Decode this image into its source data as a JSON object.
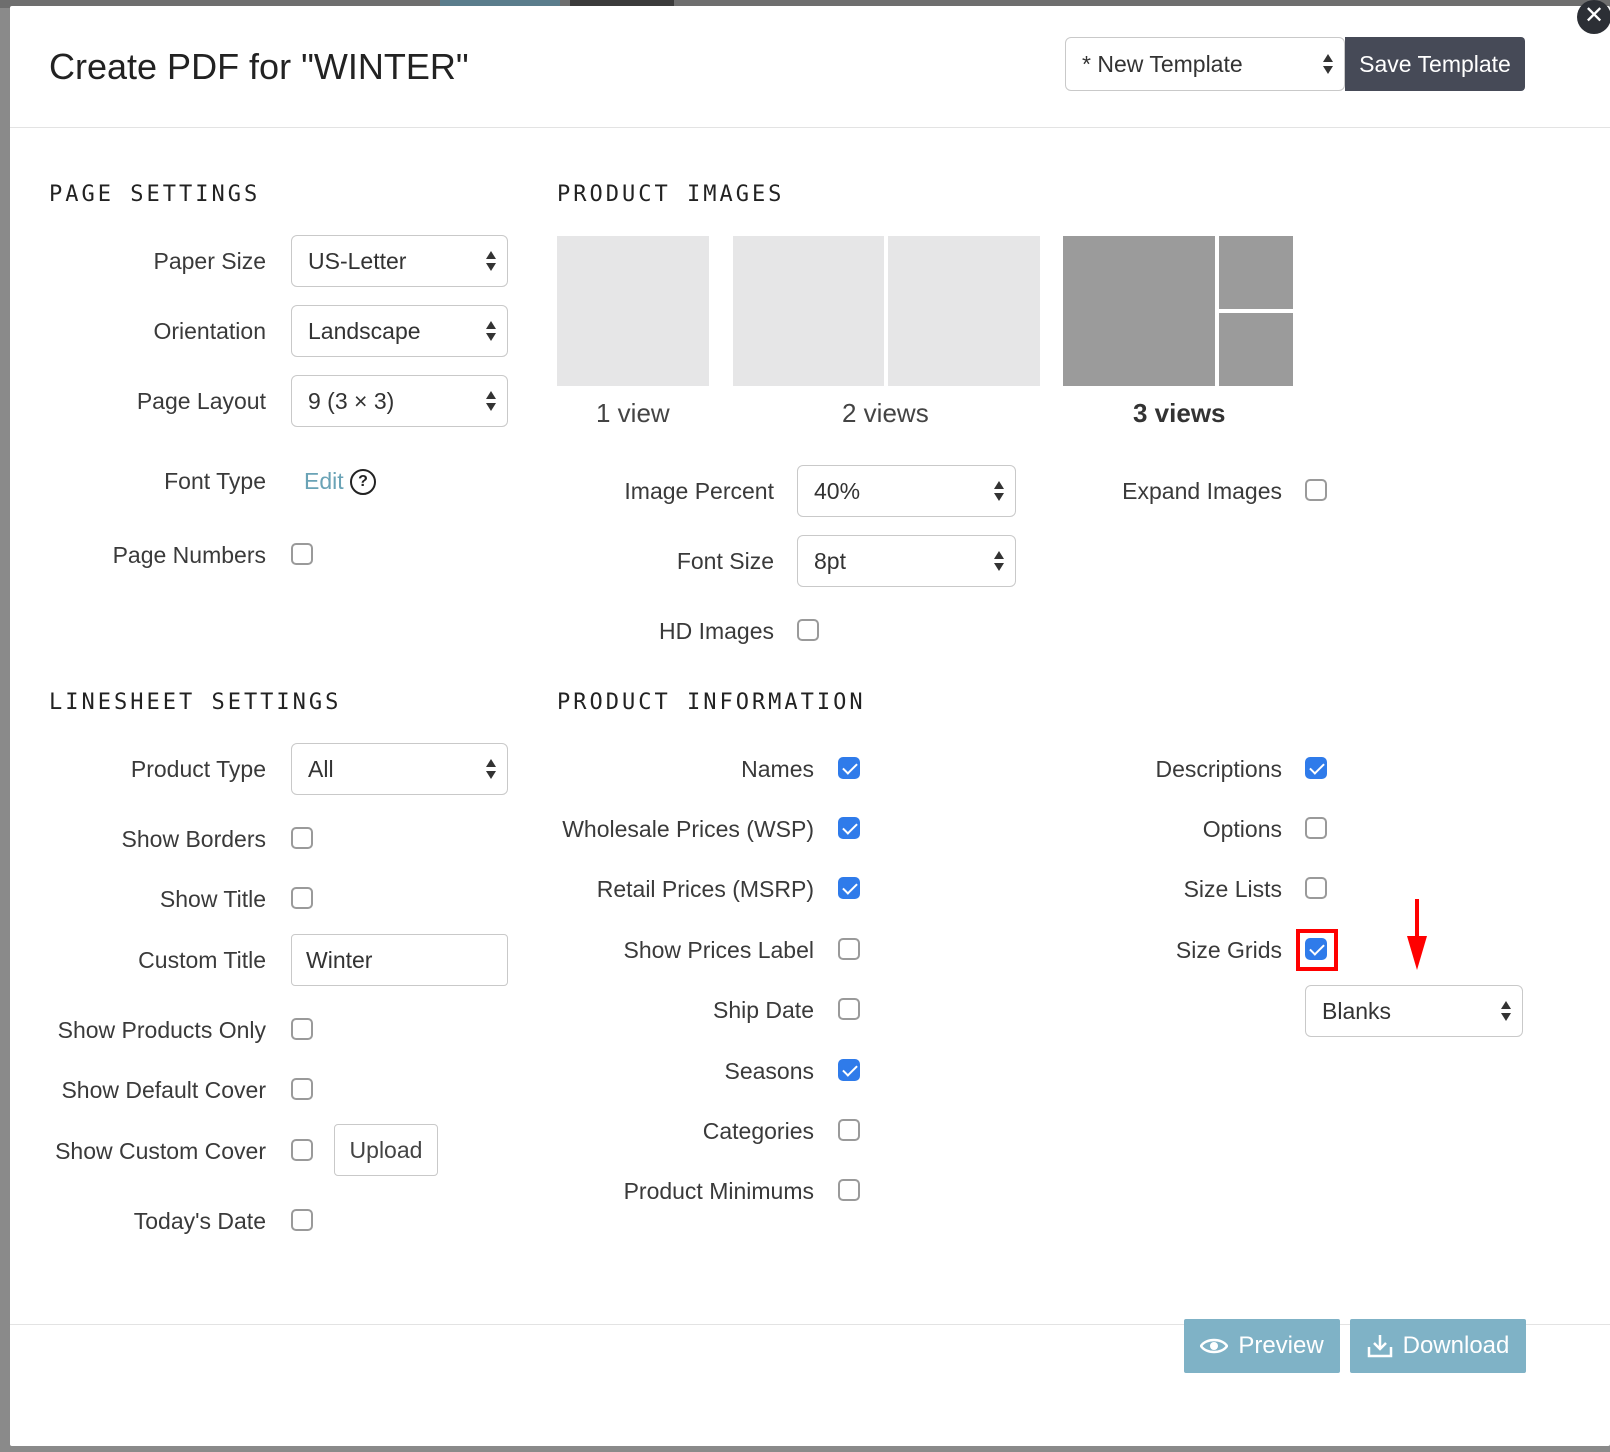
{
  "dialog": {
    "title": "Create PDF for \"WINTER\"",
    "template_select": "* New Template",
    "save_template": "Save Template",
    "close_glyph": "✕"
  },
  "page_settings": {
    "title": "PAGE SETTINGS",
    "paper_size_label": "Paper Size",
    "paper_size": "US-Letter",
    "orientation_label": "Orientation",
    "orientation": "Landscape",
    "page_layout_label": "Page Layout",
    "page_layout": "9 (3 × 3)",
    "font_type_label": "Font Type",
    "font_type_link": "Edit",
    "page_numbers_label": "Page Numbers"
  },
  "product_images": {
    "title": "PRODUCT IMAGES",
    "views": [
      "1 view",
      "2 views",
      "3 views"
    ],
    "selected": "3 views",
    "image_percent_label": "Image Percent",
    "image_percent": "40%",
    "font_size_label": "Font Size",
    "font_size": "8pt",
    "hd_images_label": "HD Images",
    "expand_images_label": "Expand Images"
  },
  "linesheet_settings": {
    "title": "LINESHEET SETTINGS",
    "product_type_label": "Product Type",
    "product_type": "All",
    "show_borders_label": "Show Borders",
    "show_title_label": "Show Title",
    "custom_title_label": "Custom Title",
    "custom_title": "Winter",
    "show_products_only_label": "Show Products Only",
    "show_default_cover_label": "Show Default Cover",
    "show_custom_cover_label": "Show Custom Cover",
    "upload_label": "Upload",
    "todays_date_label": "Today's Date"
  },
  "product_information": {
    "title": "PRODUCT INFORMATION",
    "names": "Names",
    "wholesale": "Wholesale Prices (WSP)",
    "retail": "Retail Prices (MSRP)",
    "show_prices_label": "Show Prices Label",
    "ship_date": "Ship Date",
    "seasons": "Seasons",
    "categories": "Categories",
    "product_minimums": "Product Minimums",
    "descriptions": "Descriptions",
    "options": "Options",
    "size_lists": "Size Lists",
    "size_grids": "Size Grids",
    "size_grids_select": "Blanks"
  },
  "footer": {
    "preview": "Preview",
    "download": "Download"
  },
  "colors": {
    "accent_check": "#2f7bea",
    "action_button": "#7fb2c6",
    "save_button": "#464a57",
    "highlight": "#ff0000"
  }
}
